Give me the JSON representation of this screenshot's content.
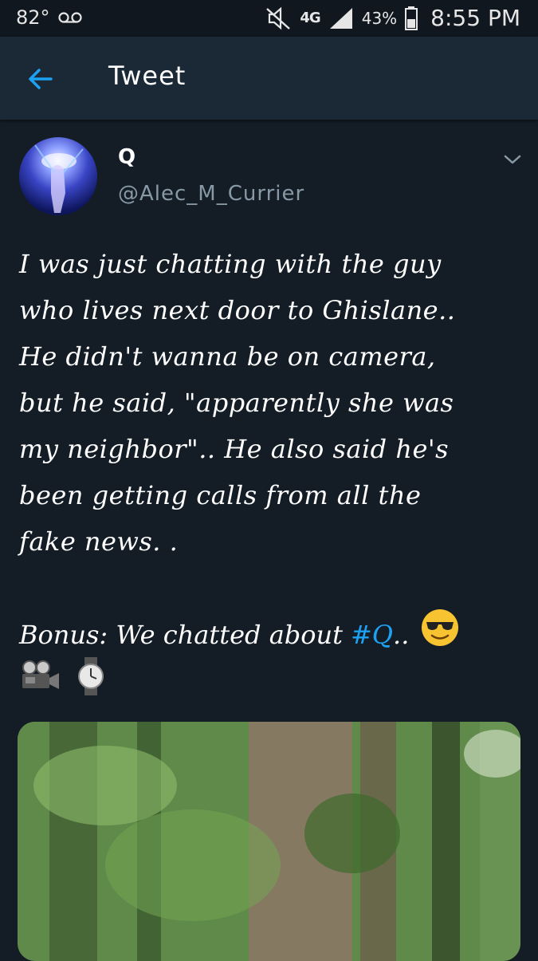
{
  "status_bar": {
    "temperature": "82°",
    "network": "4G",
    "battery": "43%",
    "time": "8:55 PM"
  },
  "app_bar": {
    "title": "Tweet"
  },
  "tweet": {
    "display_name": "Q",
    "handle": "@Alec_M_Currier",
    "text_lines": [
      "I was just chatting with the guy",
      "who lives next door to Ghislane..",
      "He didn't wanna be on camera,",
      "but he said, \"apparently she was",
      "my neighbor\".. He also said he's",
      "been getting calls from all the",
      "fake news. ."
    ],
    "bonus_prefix": "Bonus: We chatted about",
    "hashtag": "#Q",
    "bonus_suffix": ".."
  },
  "colors": {
    "background": "#141d26",
    "app_bar": "#1b2836",
    "link": "#1da1f2",
    "secondary_text": "#8899a6"
  },
  "icons": {
    "back": "arrow-left-icon",
    "caret": "chevron-down-icon",
    "sunglasses": "sunglasses-emoji",
    "camera": "movie-camera-emoji",
    "watch": "watch-emoji"
  }
}
